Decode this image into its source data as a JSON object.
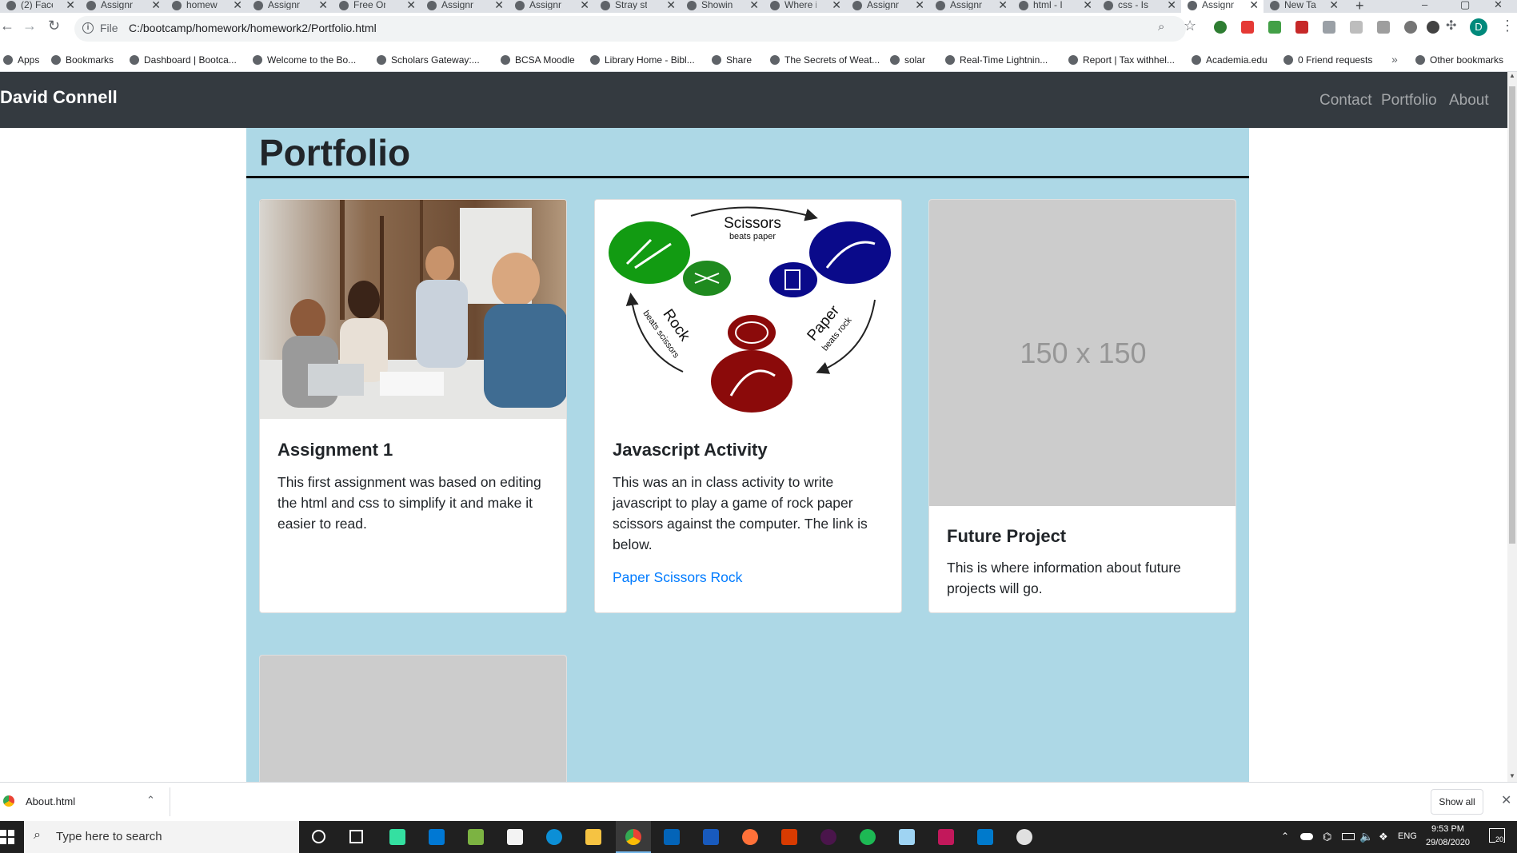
{
  "tabs": [
    {
      "title": "(2) Face"
    },
    {
      "title": "Assignm"
    },
    {
      "title": "homew"
    },
    {
      "title": "Assignm"
    },
    {
      "title": "Free On"
    },
    {
      "title": "Assignm"
    },
    {
      "title": "Assignm"
    },
    {
      "title": "Stray st"
    },
    {
      "title": "Showin"
    },
    {
      "title": "Where i"
    },
    {
      "title": "Assignm"
    },
    {
      "title": "Assignm"
    },
    {
      "title": "html - I"
    },
    {
      "title": "css - Is"
    },
    {
      "title": "Assignm"
    },
    {
      "title": "New Tab"
    }
  ],
  "address": {
    "scheme": "File",
    "url": "C:/bootcamp/homework/homework2/Portfolio.html"
  },
  "profile_initial": "D",
  "bookmarks": [
    "Apps",
    "Bookmarks",
    "Dashboard | Bootca...",
    "Welcome to the Bo...",
    "Scholars Gateway:...",
    "BCSA Moodle",
    "Library Home - Bibl...",
    "Share",
    "The Secrets of Weat...",
    "solar",
    "Real-Time Lightnin...",
    "Report | Tax withhel...",
    "Academia.edu",
    "0 Friend requests",
    "Other bookmarks"
  ],
  "navbar": {
    "brand": "David Connell",
    "links": [
      "Contact",
      "Portfolio",
      "About"
    ]
  },
  "page_title": "Portfolio",
  "cards": [
    {
      "title": "Assignment 1",
      "text": "This first assignment was based on editing the html and css to simplify it and make it easier to read."
    },
    {
      "title": "Javascript Activity",
      "text": "This was an in class activity to write javascript to play a game of rock paper scissors against the computer. The link is below.",
      "link": "Paper Scissors Rock",
      "diagram": {
        "scissors": "Scissors",
        "scissors_sub": "beats paper",
        "rock": "Rock",
        "rock_sub": "beats scissors",
        "paper": "Paper",
        "paper_sub": "beats rock"
      }
    },
    {
      "title": "Future Project",
      "text": "This is where information about future projects will go.",
      "placeholder": "150 x 150"
    }
  ],
  "download": {
    "filename": "About.html",
    "show_all": "Show all"
  },
  "taskbar": {
    "search_placeholder": "Type here to search",
    "lang": "ENG",
    "time": "9:53 PM",
    "date": "29/08/2020",
    "notifications": "20"
  }
}
